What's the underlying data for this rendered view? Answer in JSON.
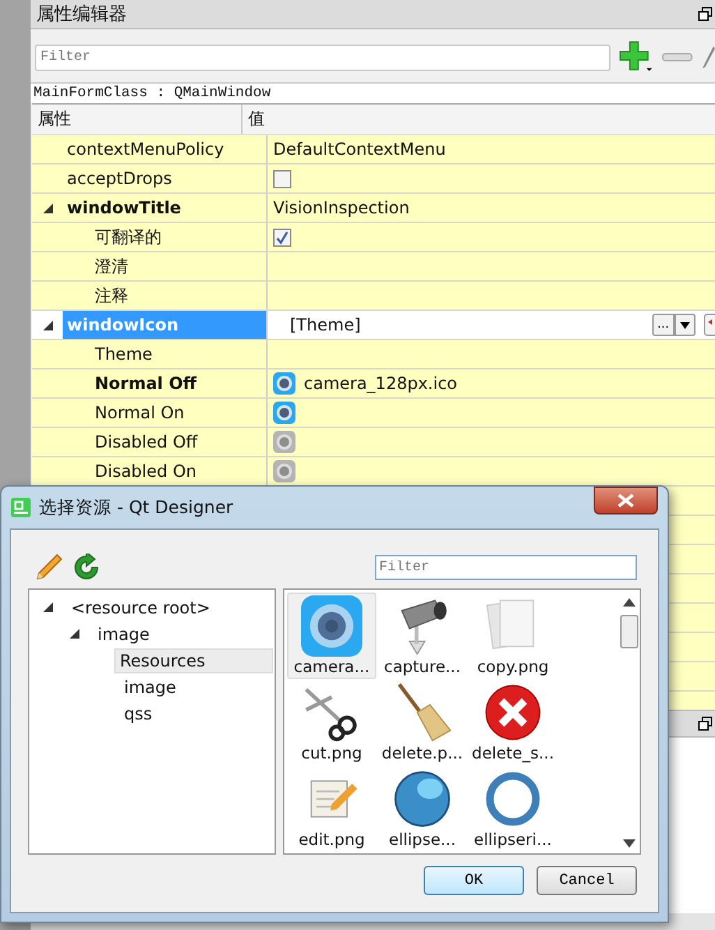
{
  "property_editor": {
    "title": "属性编辑器",
    "filter": {
      "placeholder": "Filter"
    },
    "class_label": "MainFormClass : QMainWindow",
    "columns": [
      "属性",
      "值"
    ],
    "rows": [
      {
        "name": "contextMenuPolicy",
        "kind": "text",
        "value": "DefaultContextMenu",
        "bold": false,
        "selected": false
      },
      {
        "name": "acceptDrops",
        "kind": "checkbox",
        "checked": false,
        "bold": false,
        "selected": false
      },
      {
        "name": "windowTitle",
        "kind": "text",
        "value": "VisionInspection",
        "bold": true,
        "selected": false,
        "expanded": true,
        "children": [
          {
            "name": "可翻译的",
            "kind": "checkbox",
            "checked": true,
            "bold": false,
            "selected": false
          },
          {
            "name": "澄清",
            "kind": "none",
            "bold": false,
            "selected": false
          },
          {
            "name": "注释",
            "kind": "none",
            "bold": false,
            "selected": false
          }
        ]
      },
      {
        "name": "windowIcon",
        "kind": "resource",
        "value": "[Theme]",
        "more_button": "...",
        "bold": true,
        "selected": true,
        "expanded": true,
        "children": [
          {
            "name": "Theme",
            "kind": "none",
            "bold": false,
            "selected": false
          },
          {
            "name": "Normal Off",
            "kind": "icon",
            "value": "camera_128px.ico",
            "disabled": false,
            "bold": true,
            "selected": false
          },
          {
            "name": "Normal On",
            "kind": "icon",
            "disabled": false,
            "bold": false,
            "selected": false
          },
          {
            "name": "Disabled Off",
            "kind": "icon",
            "disabled": true,
            "bold": false,
            "selected": false
          },
          {
            "name": "Disabled On",
            "kind": "icon",
            "disabled": true,
            "bold": false,
            "selected": false
          }
        ]
      }
    ]
  },
  "dialog": {
    "title": "选择资源 - Qt Designer",
    "filter": {
      "placeholder": "Filter"
    },
    "tree": [
      {
        "label": "<resource root>",
        "expanded": true,
        "selected": false,
        "children": [
          {
            "label": "image",
            "expanded": true,
            "selected": false,
            "children": [
              {
                "label": "Resources",
                "selected": true
              },
              {
                "label": "image",
                "selected": false
              },
              {
                "label": "qss",
                "selected": false
              }
            ]
          }
        ]
      }
    ],
    "files": [
      {
        "label": "camera...",
        "kind": "camera",
        "selected": true
      },
      {
        "label": "capture...",
        "kind": "webcam",
        "selected": false
      },
      {
        "label": "copy.png",
        "kind": "copy",
        "selected": false
      },
      {
        "label": "cut.png",
        "kind": "scissors",
        "selected": false
      },
      {
        "label": "delete.p...",
        "kind": "broom",
        "selected": false
      },
      {
        "label": "delete_s...",
        "kind": "delete",
        "selected": false
      },
      {
        "label": "edit.png",
        "kind": "notepad",
        "selected": false
      },
      {
        "label": "ellipse...",
        "kind": "sphere",
        "selected": false
      },
      {
        "label": "ellipseri...",
        "kind": "ring",
        "selected": false
      }
    ],
    "buttons": [
      "OK",
      "Cancel"
    ]
  }
}
